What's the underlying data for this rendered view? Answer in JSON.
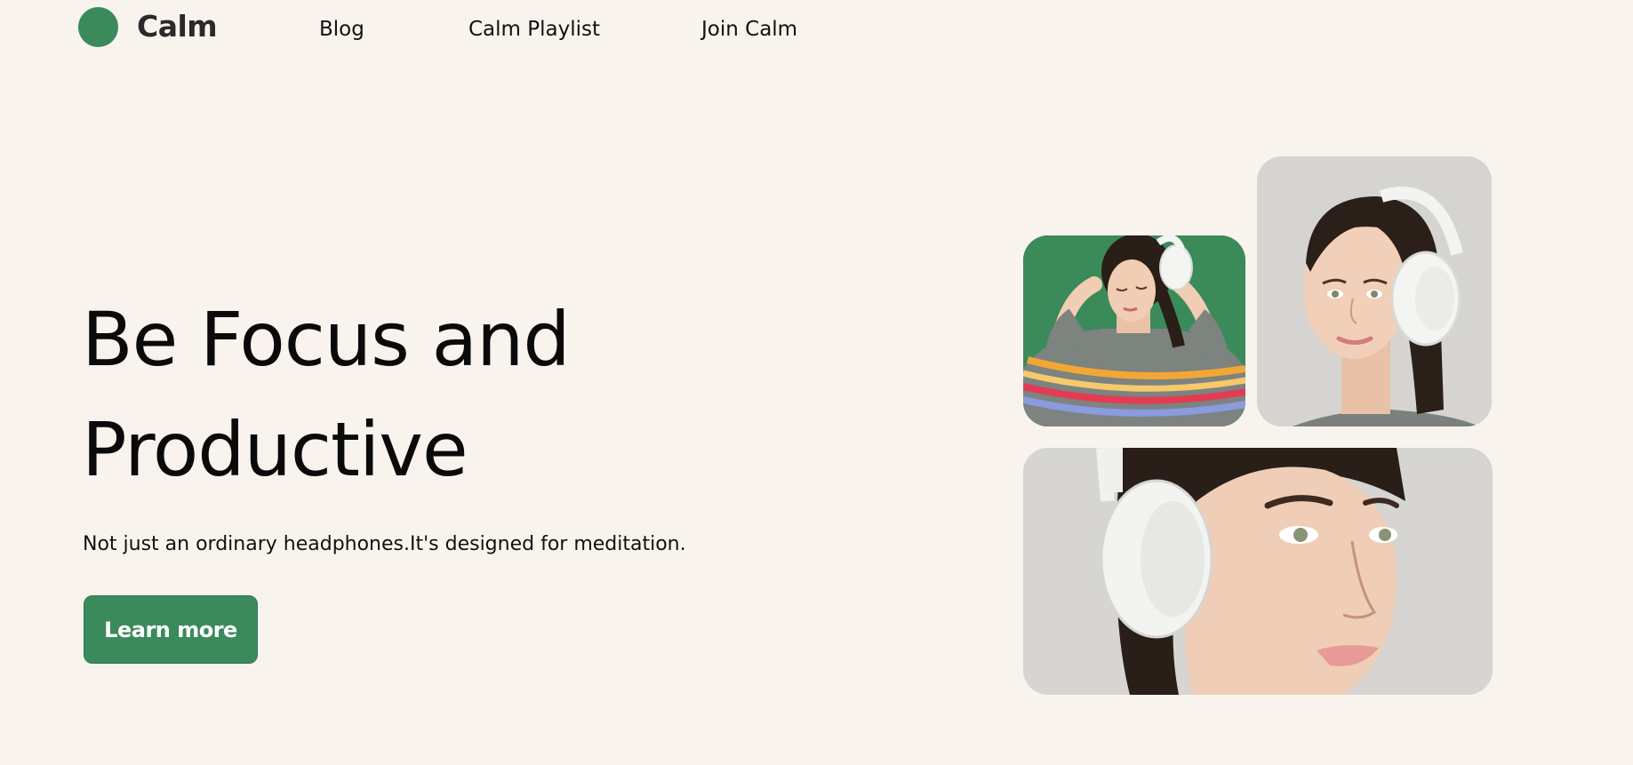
{
  "header": {
    "brand": "Calm",
    "nav": [
      {
        "label": "Blog"
      },
      {
        "label": "Calm Playlist"
      },
      {
        "label": "Join Calm"
      }
    ]
  },
  "hero": {
    "title_line1": "Be Focus and",
    "title_line2": "Productive",
    "subtitle": "Not just an ordinary headphones.It's designed for meditation.",
    "cta_label": "Learn more"
  },
  "colors": {
    "background": "#f8f4ed",
    "accent": "#3b8a5c",
    "text": "#111111"
  },
  "gallery": {
    "images": [
      {
        "name": "woman-holding-headphones-photo"
      },
      {
        "name": "woman-profile-headphones-photo"
      },
      {
        "name": "woman-closeup-headphones-photo"
      }
    ]
  }
}
